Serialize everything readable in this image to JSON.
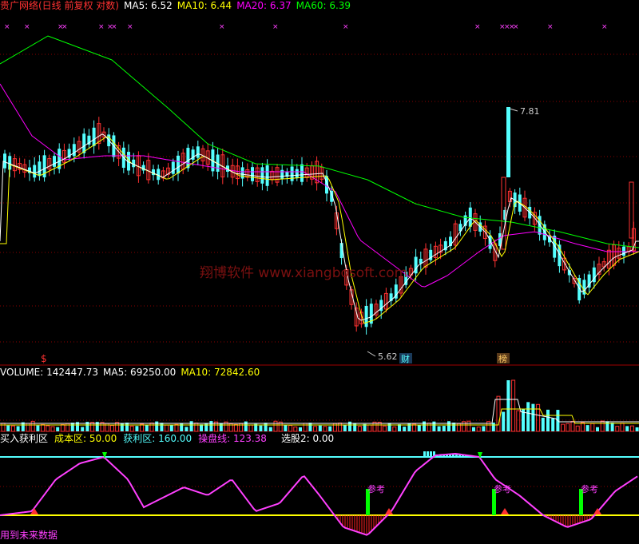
{
  "header": {
    "title": "贵广网络(日线 前复权 对数)",
    "ma5": "MA5: 6.52",
    "ma10": "MA10: 6.44",
    "ma20": "MA20: 6.37",
    "ma60": "MA60: 6.39"
  },
  "price_panel": {
    "high_label": "7.81",
    "low_label": "5.62",
    "marker_dollar": "$",
    "marker_cai": "财",
    "marker_bang": "榜",
    "watermark": "翔博软件 www.xiangbosoft.com"
  },
  "volume_panel": {
    "volume": "VOLUME: 142447.73",
    "ma5": "MA5: 69250.00",
    "ma10": "MA10: 72842.60"
  },
  "indicator_panel": {
    "name": "买入获利区",
    "cost": "成本区: 50.00",
    "profit": "获利区: 160.00",
    "trade_line": "操盘线: 123.38",
    "pick": "选股2: 0.00",
    "ref1": "参考",
    "ref2": "参考",
    "ref3": "参考",
    "footer": "用到未来数据"
  },
  "colors": {
    "up": "#ff3232",
    "down": "#54ffff",
    "ma5": "#ffffff",
    "ma10": "#ffff00",
    "ma20": "#ff00ff",
    "ma60": "#00ff00",
    "grid": "#a00000"
  },
  "chart_data": {
    "type": "candlestick",
    "high": 7.81,
    "low": 5.62,
    "series": [
      {
        "name": "MA5",
        "value": 6.52
      },
      {
        "name": "MA10",
        "value": 6.44
      },
      {
        "name": "MA20",
        "value": 6.37
      },
      {
        "name": "MA60",
        "value": 6.39
      }
    ],
    "volume": {
      "value": 142447.73,
      "ma5": 69250.0,
      "ma10": 72842.6
    },
    "indicator": {
      "cost": 50.0,
      "profit": 160.0,
      "trade_line": 123.38,
      "pick": 0.0
    }
  }
}
